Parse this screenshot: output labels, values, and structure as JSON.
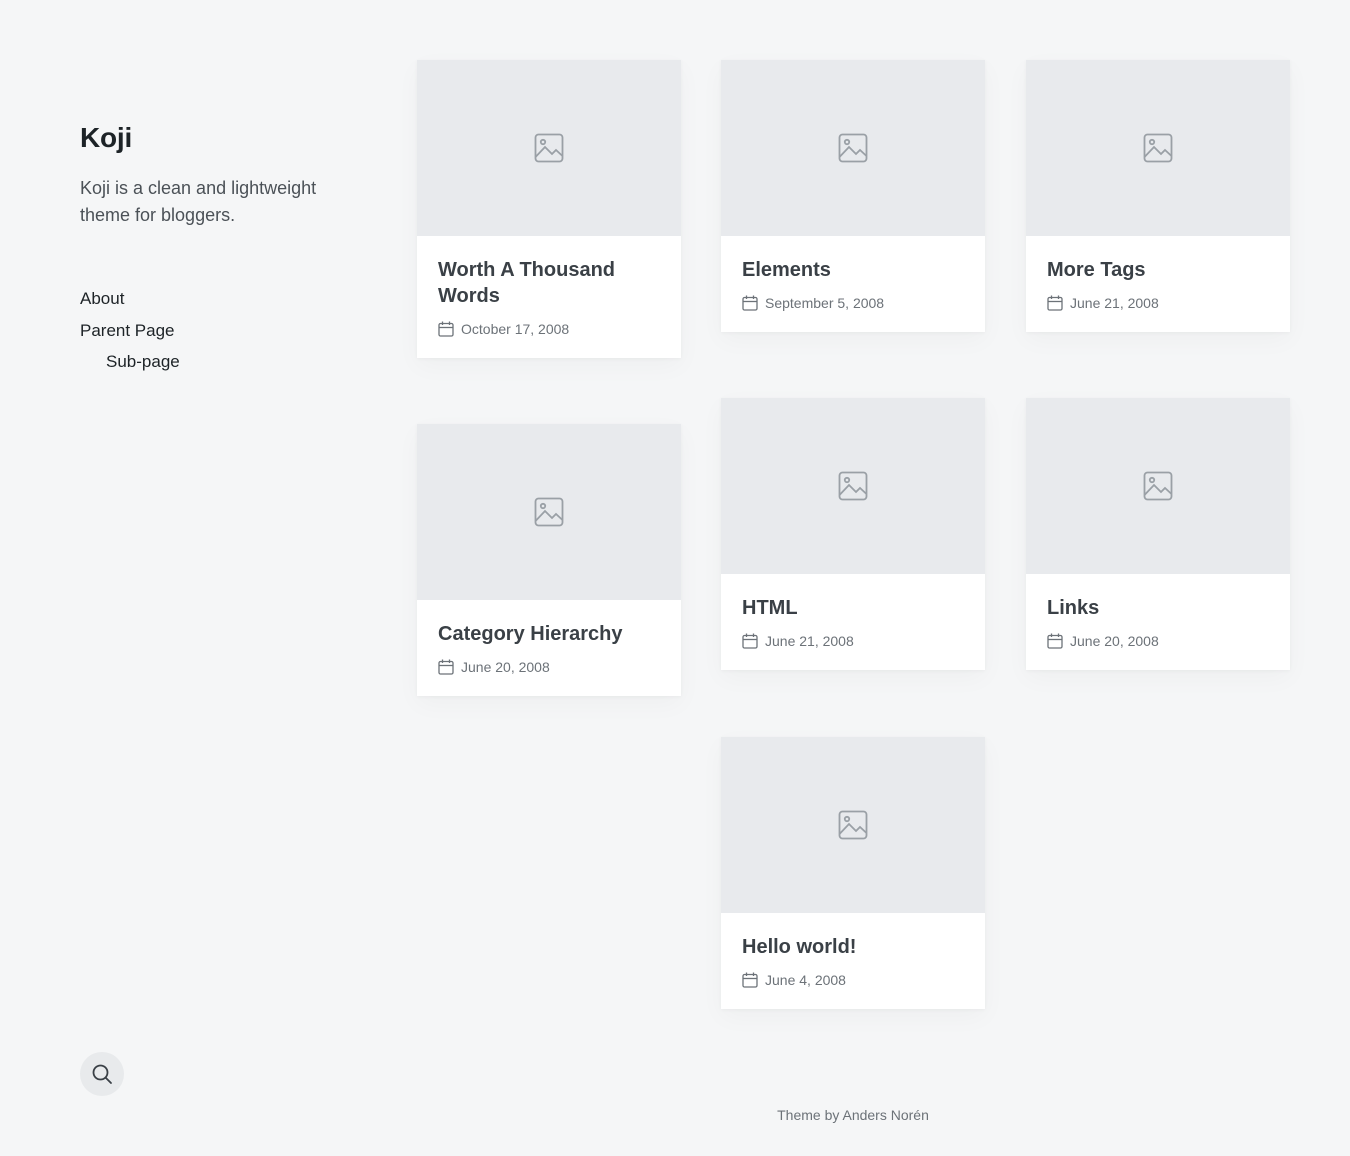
{
  "site": {
    "title": "Koji",
    "description": "Koji is a clean and lightweight theme for bloggers."
  },
  "menu": {
    "items": [
      {
        "label": "About"
      },
      {
        "label": "Parent Page"
      },
      {
        "label": "Sub-page"
      }
    ]
  },
  "search": {
    "icon": "search-icon"
  },
  "posts": [
    {
      "title": "Worth A Thousand Words",
      "date": "October 17, 2008"
    },
    {
      "title": "Elements",
      "date": "September 5, 2008"
    },
    {
      "title": "More Tags",
      "date": "June 21, 2008"
    },
    {
      "title": "Category Hierarchy",
      "date": "June 20, 2008"
    },
    {
      "title": "HTML",
      "date": "June 21, 2008"
    },
    {
      "title": "Links",
      "date": "June 20, 2008"
    },
    {
      "title": "Hello world!",
      "date": "June 4, 2008"
    }
  ],
  "footer": {
    "credit": "Theme by Anders Norén"
  },
  "colors": {
    "background": "#f5f6f7",
    "thumb_placeholder": "#e8eaed",
    "title_text": "#3a4046",
    "meta_text": "#6c7278"
  }
}
